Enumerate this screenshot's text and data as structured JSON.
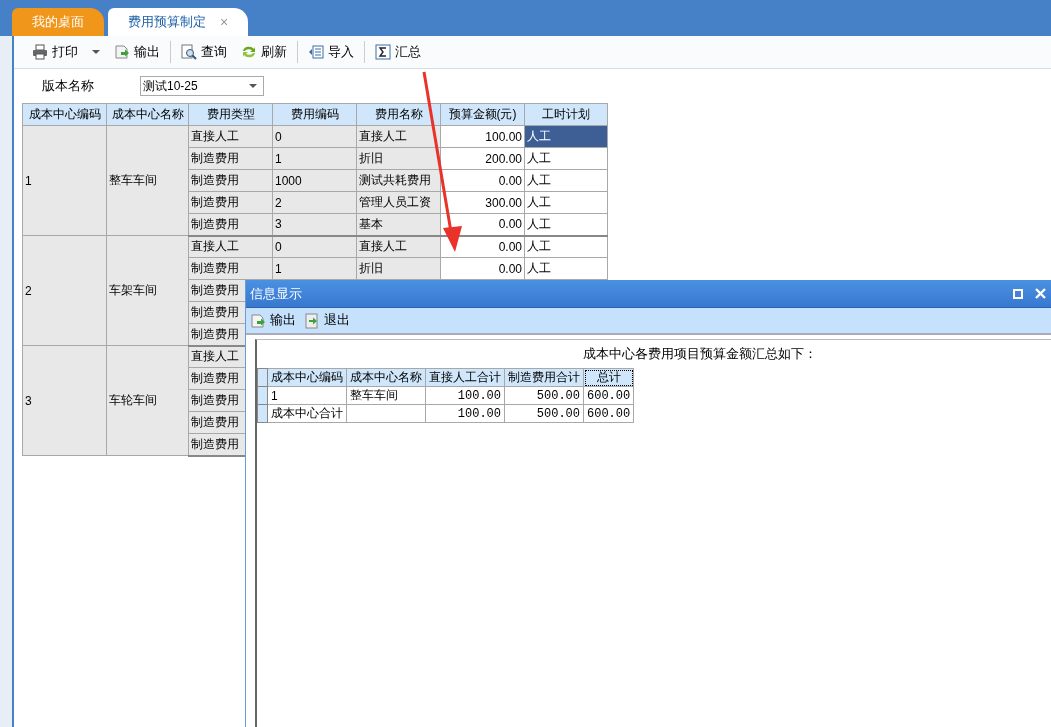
{
  "tabs": [
    {
      "label": "我的桌面",
      "selected": false
    },
    {
      "label": "费用预算制定",
      "selected": true,
      "close": "×"
    }
  ],
  "toolbar": [
    [
      {
        "label": "打印",
        "kind": "printer",
        "dropdown": true
      },
      {
        "label": "输出",
        "kind": "export",
        "dropdown": false
      }
    ],
    [
      {
        "label": "查询",
        "kind": "query",
        "dropdown": false
      },
      {
        "label": "刷新",
        "kind": "refresh",
        "dropdown": false
      }
    ],
    [
      {
        "label": "导入",
        "kind": "import",
        "dropdown": false
      }
    ],
    [
      {
        "label": "汇总",
        "kind": "sum",
        "dropdown": false
      }
    ]
  ],
  "version": {
    "label": "版本名称",
    "value": "测试10-25"
  },
  "grid": {
    "columns": [
      "成本中心编码",
      "成本中心名称",
      "费用类型",
      "费用编码",
      "费用名称",
      "预算金额(元)",
      "工时计划"
    ],
    "groups": [
      {
        "code": "1",
        "name": "整车车间",
        "rows": [
          {
            "type": "直接人工",
            "code": "0",
            "name": "直接人工",
            "amount": "100.00",
            "plan": "人工",
            "selected": true
          },
          {
            "type": "制造费用",
            "code": "1",
            "name": "折旧",
            "amount": "200.00",
            "plan": "人工",
            "selected": false
          },
          {
            "type": "制造费用",
            "code": "1000",
            "name": "测试共耗费用",
            "amount": "0.00",
            "plan": "人工",
            "selected": false
          },
          {
            "type": "制造费用",
            "code": "2",
            "name": "管理人员工资",
            "amount": "300.00",
            "plan": "人工",
            "selected": false
          },
          {
            "type": "制造费用",
            "code": "3",
            "name": "基本",
            "amount": "0.00",
            "plan": "人工",
            "selected": false
          }
        ]
      },
      {
        "code": "2",
        "name": "车架车间",
        "rows": [
          {
            "type": "直接人工",
            "code": "0",
            "name": "直接人工",
            "amount": "0.00",
            "plan": "人工",
            "selected": false
          },
          {
            "type": "制造费用",
            "code": "1",
            "name": "折旧",
            "amount": "0.00",
            "plan": "人工",
            "selected": false
          },
          {
            "type": "制造费用"
          },
          {
            "type": "制造费用"
          },
          {
            "type": "制造费用"
          }
        ]
      },
      {
        "code": "3",
        "name": "车轮车间",
        "rows": [
          {
            "type": "直接人工"
          },
          {
            "type": "制造费用"
          },
          {
            "type": "制造费用"
          },
          {
            "type": "制造费用"
          },
          {
            "type": "制造费用"
          }
        ]
      }
    ]
  },
  "dialog": {
    "title": "信息显示",
    "toolbar": [
      {
        "label": "输出",
        "kind": "export"
      },
      {
        "label": "退出",
        "kind": "exit"
      }
    ],
    "caption": "成本中心各费用项目预算金额汇总如下：",
    "columns": [
      {
        "label": "成本中心编码",
        "focused": false
      },
      {
        "label": "成本中心名称",
        "focused": false
      },
      {
        "label": "直接人工合计",
        "focused": false
      },
      {
        "label": "制造费用合计",
        "focused": false
      },
      {
        "label": "总计",
        "focused": true
      }
    ],
    "rows": [
      [
        "1",
        "整车车间",
        "100.00",
        "500.00",
        "600.00"
      ],
      [
        "成本中心合计",
        "",
        "100.00",
        "500.00",
        "600.00"
      ]
    ]
  }
}
